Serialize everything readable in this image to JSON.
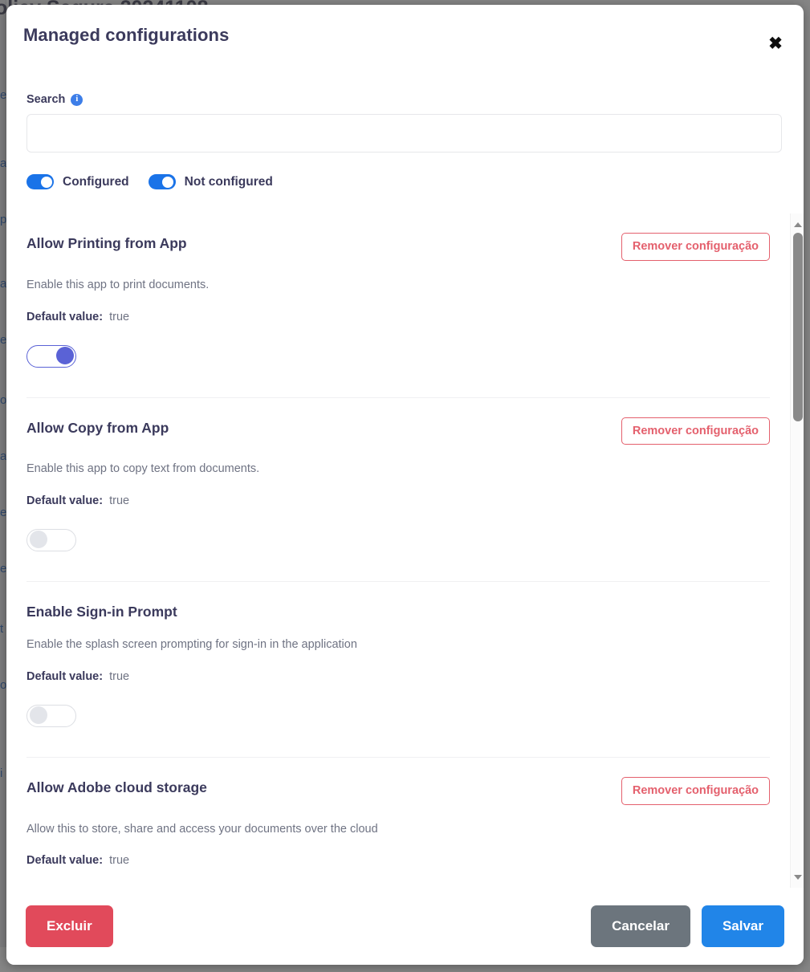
{
  "background": {
    "page_title": "olicy Segura 20241108",
    "edge_fragments": [
      "e",
      "a",
      "p",
      "a",
      "e",
      "o",
      "a",
      "e",
      "e",
      "t",
      "o",
      "i"
    ]
  },
  "modal": {
    "title": "Managed configurations",
    "close_icon": "close-icon",
    "close_glyph": "✖"
  },
  "search": {
    "label": "Search",
    "info_icon": "info-icon",
    "info_glyph": "i",
    "value": "",
    "placeholder": ""
  },
  "filters": [
    {
      "label": "Configured",
      "state": "on"
    },
    {
      "label": "Not configured",
      "state": "on"
    }
  ],
  "configurations": [
    {
      "title": "Allow Printing from App",
      "description": "Enable this app to print documents.",
      "default_label": "Default value:",
      "default_value": "true",
      "toggle_state": "on",
      "remove_label": "Remover configuração",
      "has_remove": true
    },
    {
      "title": "Allow Copy from App",
      "description": "Enable this app to copy text from documents.",
      "default_label": "Default value:",
      "default_value": "true",
      "toggle_state": "off",
      "remove_label": "Remover configuração",
      "has_remove": true
    },
    {
      "title": "Enable Sign-in Prompt",
      "description": "Enable the splash screen prompting for sign-in in the application",
      "default_label": "Default value:",
      "default_value": "true",
      "toggle_state": "off",
      "remove_label": "",
      "has_remove": false
    },
    {
      "title": "Allow Adobe cloud storage",
      "description": "Allow this to store, share and access your documents over the cloud",
      "default_label": "Default value:",
      "default_value": "true",
      "toggle_state": "off",
      "remove_label": "Remover configuração",
      "has_remove": true
    }
  ],
  "scrollbar": {
    "up_arrow": "scroll-up-arrow",
    "down_arrow": "scroll-down-arrow",
    "thumb": "scroll-thumb"
  },
  "footer": {
    "delete_label": "Excluir",
    "cancel_label": "Cancelar",
    "save_label": "Salvar"
  },
  "colors": {
    "title": "#3b3a5c",
    "danger": "#e14a5b",
    "remove_outline": "#e4606d",
    "primary": "#2185e8",
    "cancel": "#6c757d",
    "toggle_on": "#5a62d6",
    "filter_on": "#1a73e8",
    "description": "#6f7383"
  }
}
